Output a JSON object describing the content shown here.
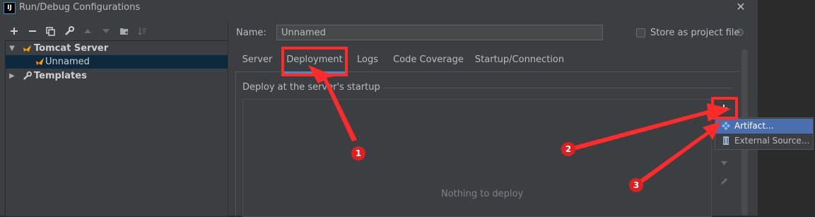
{
  "window": {
    "title": "Run/Debug Configurations",
    "app_icon_text": "IJ"
  },
  "toolbar": {
    "buttons": [
      {
        "name": "add-icon",
        "glyph": "+"
      },
      {
        "name": "remove-icon",
        "glyph": "−"
      },
      {
        "name": "copy-icon",
        "glyph": "⧉"
      },
      {
        "name": "edit-defaults-icon",
        "glyph": "🔧"
      },
      {
        "name": "move-up-icon",
        "glyph": "▲"
      },
      {
        "name": "move-down-icon",
        "glyph": "▼"
      },
      {
        "name": "new-folder-icon",
        "glyph": "📁"
      },
      {
        "name": "sort-icon",
        "glyph": "⇅"
      }
    ]
  },
  "tree": {
    "tomcat_server": "Tomcat Server",
    "unnamed": "Unnamed",
    "templates": "Templates"
  },
  "form": {
    "name_label": "Name:",
    "name_value": "Unnamed",
    "store_label": "Store as project file"
  },
  "tabs": [
    "Server",
    "Deployment",
    "Logs",
    "Code Coverage",
    "Startup/Connection"
  ],
  "deployment": {
    "group_title": "Deploy at the server's startup",
    "empty_text": "Nothing to deploy"
  },
  "popup": {
    "items": [
      "Artifact...",
      "External Source..."
    ]
  },
  "annotations": {
    "badges": [
      "1",
      "2",
      "3"
    ]
  },
  "colors": {
    "accent": "#4a88c7",
    "highlight": "#4b6eaf",
    "annotation_red": "#ff2a2a"
  }
}
